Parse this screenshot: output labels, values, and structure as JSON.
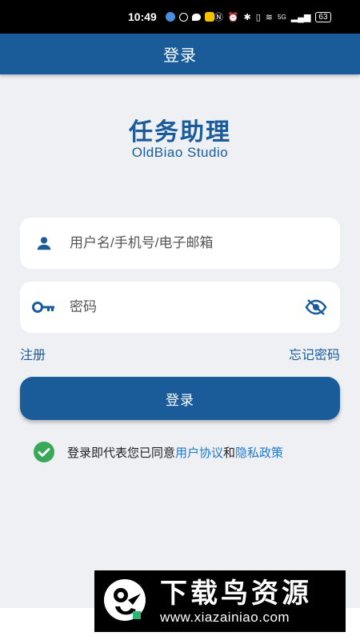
{
  "status_bar": {
    "time": "10:49",
    "network": "5G",
    "battery": "63"
  },
  "app_bar": {
    "title": "登录"
  },
  "brand": {
    "title": "任务助理",
    "subtitle": "OldBiao Studio"
  },
  "form": {
    "username_placeholder": "用户名/手机号/电子邮箱",
    "password_placeholder": "密码",
    "register_label": "注册",
    "forgot_label": "忘记密码",
    "login_label": "登录"
  },
  "agreement": {
    "prefix": "登录即代表您已同意",
    "user_agreement": "用户协议",
    "connector": "和",
    "privacy_policy": "隐私政策"
  },
  "watermark": {
    "title": "下载鸟资源",
    "url": "www.xiazainiao.com"
  },
  "colors": {
    "primary": "#1a5c9a",
    "link": "#1f7ad1",
    "check": "#3aa859",
    "background": "#eef0f4"
  },
  "icons": [
    "person-icon",
    "key-icon",
    "eye-off-icon",
    "check-circle-icon"
  ]
}
